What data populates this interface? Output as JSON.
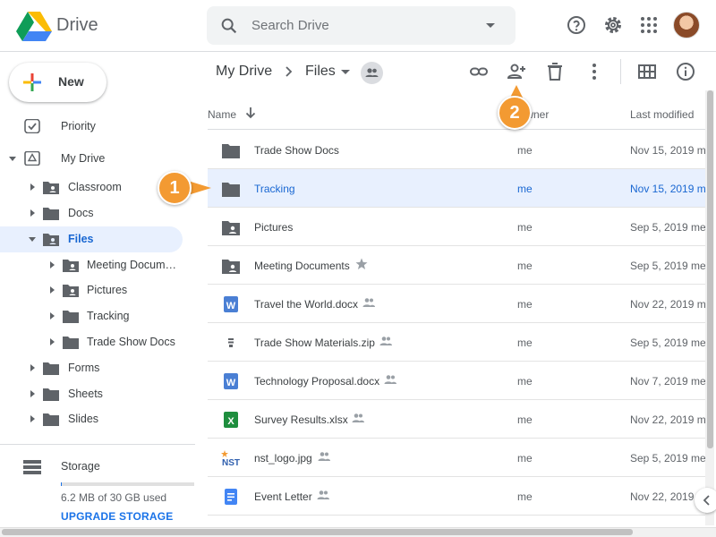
{
  "app": {
    "name": "Drive"
  },
  "search": {
    "placeholder": "Search Drive"
  },
  "sidebar": {
    "new_label": "New",
    "items": [
      {
        "label": "Priority"
      },
      {
        "label": "My Drive"
      },
      {
        "label": "Classroom"
      },
      {
        "label": "Docs"
      },
      {
        "label": "Files"
      },
      {
        "label": "Meeting Documen..."
      },
      {
        "label": "Pictures"
      },
      {
        "label": "Tracking"
      },
      {
        "label": "Trade Show Docs"
      },
      {
        "label": "Forms"
      },
      {
        "label": "Sheets"
      },
      {
        "label": "Slides"
      }
    ],
    "storage_label": "Storage",
    "storage_used": "6.2 MB of 30 GB used",
    "storage_fraction": 0.0002,
    "upgrade_label": "UPGRADE STORAGE"
  },
  "breadcrumb": {
    "root": "My Drive",
    "current": "Files"
  },
  "list": {
    "columns": {
      "name": "Name",
      "owner": "Owner",
      "modified": "Last modified"
    },
    "rows": [
      {
        "name": "Trade Show Docs",
        "owner": "me",
        "modified": "Nov 15, 2019 m",
        "icon": "folder-icon"
      },
      {
        "name": "Tracking",
        "owner": "me",
        "modified": "Nov 15, 2019 m",
        "icon": "folder-icon"
      },
      {
        "name": "Pictures",
        "owner": "me",
        "modified": "Sep 5, 2019 me",
        "icon": "shared-folder-icon"
      },
      {
        "name": "Meeting Documents",
        "owner": "me",
        "modified": "Sep 5, 2019 me",
        "icon": "shared-folder-icon"
      },
      {
        "name": "Travel the World.docx",
        "owner": "me",
        "modified": "Nov 22, 2019 m",
        "icon": "word-doc-icon"
      },
      {
        "name": "Trade Show Materials.zip",
        "owner": "me",
        "modified": "Sep 5, 2019 me",
        "icon": "zip-file-icon"
      },
      {
        "name": "Technology Proposal.docx",
        "owner": "me",
        "modified": "Nov 7, 2019 me",
        "icon": "word-doc-icon"
      },
      {
        "name": "Survey Results.xlsx",
        "owner": "me",
        "modified": "Nov 22, 2019 m",
        "icon": "excel-sheet-icon"
      },
      {
        "name": "nst_logo.jpg",
        "owner": "me",
        "modified": "Sep 5, 2019 me",
        "icon": "image-file-icon"
      },
      {
        "name": "Event Letter",
        "owner": "me",
        "modified": "Nov 22, 2019 m",
        "icon": "google-doc-icon"
      }
    ]
  },
  "callouts": {
    "one": "1",
    "two": "2"
  },
  "colors": {
    "accent": "#1a73e8",
    "selected_bg": "#e8f0fe",
    "callout": "#f39a32"
  }
}
